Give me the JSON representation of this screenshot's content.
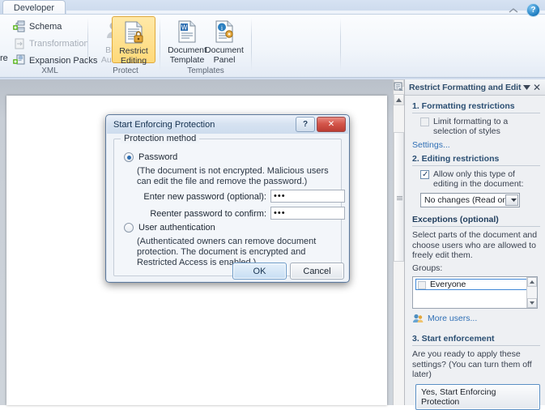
{
  "ribbon": {
    "tab_label": "Developer",
    "collapse_icon": "chevron-up-icon",
    "help_label": "?",
    "groups": [
      {
        "name": "XML",
        "label": "XML",
        "cut_off_item": "re",
        "items": [
          {
            "label": "Schema",
            "icon": "schema-icon",
            "disabled": false
          },
          {
            "label": "Transformation",
            "icon": "transformation-icon",
            "disabled": true
          },
          {
            "label": "Expansion Packs",
            "icon": "expansion-packs-icon",
            "disabled": false
          }
        ]
      },
      {
        "name": "Protect",
        "label": "Protect",
        "buttons": [
          {
            "line1": "Block",
            "line2": "Authors",
            "icon": "block-authors-icon",
            "disabled": true,
            "selected": false,
            "has_dropdown": true
          },
          {
            "line1": "Restrict",
            "line2": "Editing",
            "icon": "restrict-editing-icon",
            "disabled": false,
            "selected": true,
            "has_dropdown": false
          }
        ]
      },
      {
        "name": "Templates",
        "label": "Templates",
        "buttons": [
          {
            "line1": "Document",
            "line2": "Template",
            "icon": "document-template-icon",
            "disabled": false,
            "selected": false,
            "has_dropdown": false
          },
          {
            "line1": "Document",
            "line2": "Panel",
            "icon": "document-panel-icon",
            "disabled": false,
            "selected": false,
            "has_dropdown": false
          }
        ]
      }
    ]
  },
  "task_pane": {
    "title": "Restrict Formatting and Editing",
    "caret_icon": "chevron-down-icon",
    "close_icon": "close-icon",
    "pane_icon": "task-pane-icon",
    "section1": {
      "heading": "1. Formatting restrictions",
      "checkbox_label": "Limit formatting to a selection of styles",
      "checkbox_checked": false,
      "settings_link": "Settings..."
    },
    "section2": {
      "heading": "2. Editing restrictions",
      "checkbox_label": "Allow only this type of editing in the document:",
      "checkbox_checked": true,
      "dropdown_value": "No changes (Read only)",
      "dropdown_icon": "chevron-down-icon"
    },
    "exceptions": {
      "heading": "Exceptions (optional)",
      "description": "Select parts of the document and choose users who are allowed to freely edit them.",
      "groups_label": "Groups:",
      "group_items": [
        {
          "label": "Everyone",
          "checked": false,
          "selected": true
        }
      ],
      "more_users_label": "More users...",
      "more_users_icon": "users-icon",
      "scroll_up_icon": "triangle-up-icon",
      "scroll_down_icon": "triangle-down-icon"
    },
    "section3": {
      "heading": "3. Start enforcement",
      "description": "Are you ready to apply these settings? (You can turn them off later)",
      "button_label": "Yes, Start Enforcing Protection"
    }
  },
  "scrollbar": {
    "name": "document-vertical-scrollbar",
    "up_arrow_icon": "triangle-up-icon",
    "grip_icon": "grip-icon"
  },
  "dialog": {
    "title": "Start Enforcing Protection",
    "help_button_label": "?",
    "close_button_label": "✕",
    "group_caption": "Protection method",
    "option_password": {
      "label": "Password",
      "accel": "a",
      "selected": true,
      "hint": "(The document is not encrypted. Malicious users can edit the file and remove the password.)"
    },
    "field_new_password": {
      "label": "Enter new password (optional):",
      "value": "•••"
    },
    "field_confirm_password": {
      "label": "Reenter password to confirm:",
      "value": "•••"
    },
    "option_user_auth": {
      "label": "User authentication",
      "selected": false,
      "hint": "(Authenticated owners can remove document protection. The document is encrypted and Restricted Access is enabled.)"
    },
    "ok_label": "OK",
    "cancel_label": "Cancel"
  },
  "colors": {
    "ribbon_selected": "#ffd979",
    "link": "#2f6fb5",
    "heading": "#2b4f73",
    "dialog_close": "#d4564b",
    "focus_border": "#3f87d6"
  }
}
